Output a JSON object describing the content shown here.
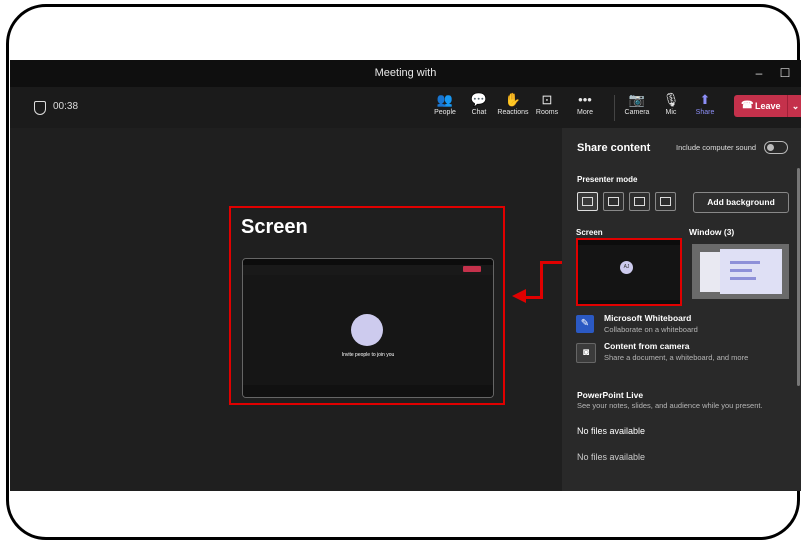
{
  "window": {
    "title": "Meeting with",
    "minimize": "–",
    "maximize": "☐"
  },
  "meeting": {
    "timer": "00:38"
  },
  "toolbar": {
    "items": [
      {
        "label": "People",
        "icon": "people-icon",
        "glyph": "👥"
      },
      {
        "label": "Chat",
        "icon": "chat-icon",
        "glyph": "💬"
      },
      {
        "label": "Reactions",
        "icon": "reactions-icon",
        "glyph": "✋"
      },
      {
        "label": "Rooms",
        "icon": "rooms-icon",
        "glyph": "⊡"
      },
      {
        "label": "More",
        "icon": "more-icon",
        "glyph": "•••"
      },
      {
        "label": "Camera",
        "icon": "camera-off-icon",
        "glyph": "📷"
      },
      {
        "label": "Mic",
        "icon": "mic-icon",
        "glyph": "🎙"
      },
      {
        "label": "Share",
        "icon": "share-icon",
        "glyph": "⬆"
      }
    ],
    "leave_label": "Leave",
    "leave_color": "#c4314b",
    "accent_color": "#8c8ef7"
  },
  "preview": {
    "title": "Screen",
    "invite_text": "Invite people to join you",
    "highlight_color": "#e00000"
  },
  "share_panel": {
    "title": "Share content",
    "include_sound_label": "Include computer sound",
    "presenter_mode_label": "Presenter mode",
    "add_background_label": "Add background",
    "screen_label": "Screen",
    "screen_avatar_initials": "AJ",
    "window_label": "Window (3)",
    "options": [
      {
        "title": "Microsoft Whiteboard",
        "desc": "Collaborate on a whiteboard",
        "icon": "whiteboard-icon"
      },
      {
        "title": "Content from camera",
        "desc": "Share a document, a whiteboard, and more",
        "icon": "camera-content-icon"
      }
    ],
    "powerpoint_title": "PowerPoint Live",
    "powerpoint_desc": "See your notes, slides, and audience while you present.",
    "no_files": "No files available",
    "no_files_partial": "No files available"
  }
}
